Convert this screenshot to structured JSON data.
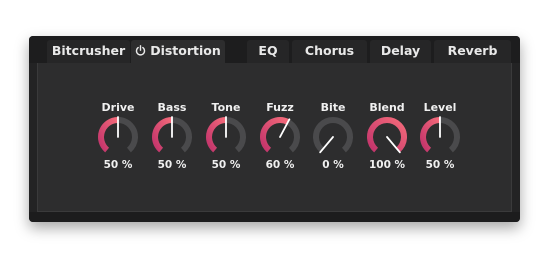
{
  "tabs": [
    {
      "label": "Bitcrusher",
      "active": false
    },
    {
      "label": "Distortion",
      "active": true,
      "icon": "power-icon"
    },
    {
      "label": "EQ",
      "active": false
    },
    {
      "label": "Chorus",
      "active": false
    },
    {
      "label": "Delay",
      "active": false
    },
    {
      "label": "Reverb",
      "active": false
    }
  ],
  "knobs": [
    {
      "label": "Drive",
      "value": 50,
      "value_text": "50 %"
    },
    {
      "label": "Bass",
      "value": 50,
      "value_text": "50 %"
    },
    {
      "label": "Tone",
      "value": 50,
      "value_text": "50 %"
    },
    {
      "label": "Fuzz",
      "value": 60,
      "value_text": "60 %"
    },
    {
      "label": "Bite",
      "value": 0,
      "value_text": "0 %"
    },
    {
      "label": "Blend",
      "value": 100,
      "value_text": "100 %"
    },
    {
      "label": "Level",
      "value": 50,
      "value_text": "50 %"
    }
  ],
  "colors": {
    "arc_start": "#c2336b",
    "arc_end": "#f46a7a",
    "track": "#4a4a4c",
    "pointer": "#ffffff"
  }
}
